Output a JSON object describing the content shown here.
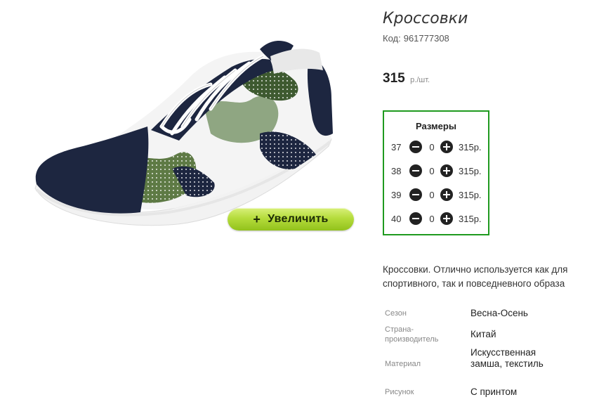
{
  "product": {
    "title": "Кроссовки",
    "code_label": "Код:",
    "code": "961777308",
    "price": "315",
    "price_unit": "р./шт."
  },
  "zoom_button": {
    "label": "Увеличить",
    "icon": "plus-icon"
  },
  "sizes": {
    "title": "Размеры",
    "rows": [
      {
        "size": "37",
        "qty": "0",
        "price": "315р."
      },
      {
        "size": "38",
        "qty": "0",
        "price": "315р."
      },
      {
        "size": "39",
        "qty": "0",
        "price": "315р."
      },
      {
        "size": "40",
        "qty": "0",
        "price": "315р."
      }
    ]
  },
  "description": "Кроссовки. Отлично используется как для спортивного, так и повседневного образа",
  "specs": [
    {
      "label": "Сезон",
      "value": "Весна-Осень"
    },
    {
      "label": "Страна-производитель",
      "value": "Китай"
    },
    {
      "label": "Материал",
      "value": "Искусственная замша, текстиль"
    },
    {
      "label": "Рисунок",
      "value": "С принтом"
    }
  ],
  "colors": {
    "sizes_border": "#1f9a1f",
    "zoom_button_green": "#b5dc3c",
    "shoe_navy": "#1d2640",
    "camo_green": "#5e7a45"
  }
}
